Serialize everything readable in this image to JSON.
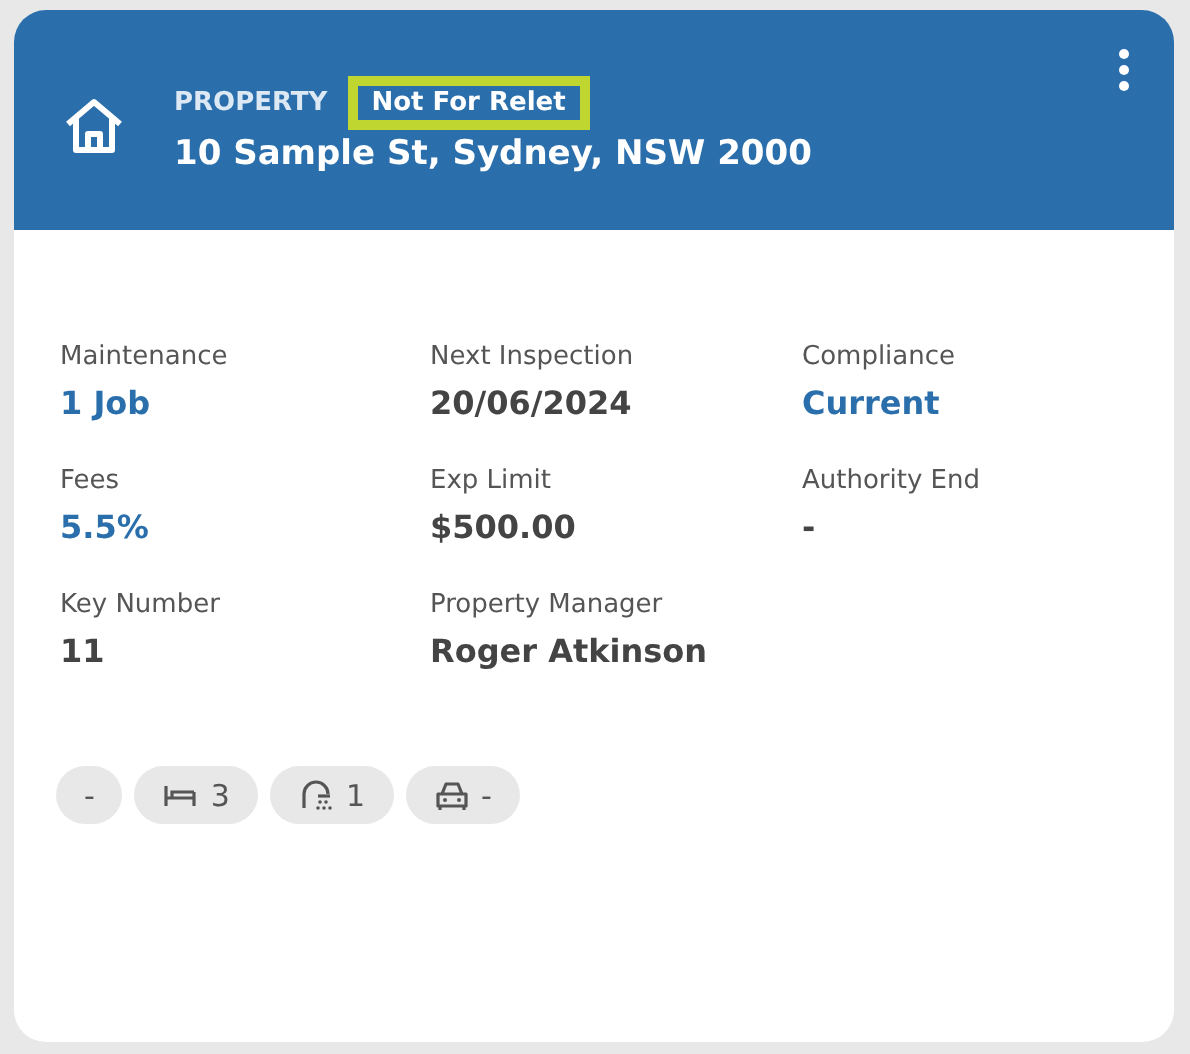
{
  "header": {
    "label": "PROPERTY",
    "status": "Not For Relet",
    "status_highlighted": true,
    "address": "10 Sample St, Sydney, NSW 2000"
  },
  "fields": [
    {
      "label": "Maintenance",
      "value": "1 Job",
      "link": true
    },
    {
      "label": "Next Inspection",
      "value": "20/06/2024",
      "link": false
    },
    {
      "label": "Compliance",
      "value": "Current",
      "link": true
    },
    {
      "label": "Fees",
      "value": "5.5%",
      "link": true
    },
    {
      "label": "Exp Limit",
      "value": "$500.00",
      "link": false
    },
    {
      "label": "Authority End",
      "value": "-",
      "link": false
    },
    {
      "label": "Key Number",
      "value": "11",
      "link": false
    },
    {
      "label": "Property Manager",
      "value": "Roger Atkinson",
      "link": false
    }
  ],
  "chips": [
    {
      "kind": "plain",
      "text": "-"
    },
    {
      "kind": "bed",
      "text": "3"
    },
    {
      "kind": "bath",
      "text": "1"
    },
    {
      "kind": "car",
      "text": "-"
    }
  ]
}
